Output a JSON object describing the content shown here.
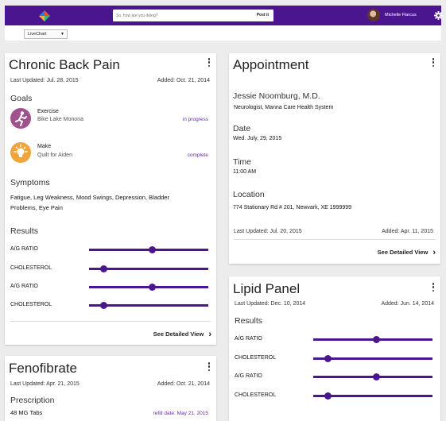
{
  "header": {
    "status_placeholder": "So, how are you doing?",
    "post_label": "Post it",
    "user_name": "Michelle Flarcus",
    "brand_color": "#4b1590"
  },
  "subbar": {
    "view_selected": "LiveChart"
  },
  "back_pain": {
    "title": "Chronic Back Pain",
    "last_updated": "Last Updated: Jul. 28, 2015",
    "added": "Added: Oct. 21, 2014",
    "goals_heading": "Goals",
    "goals": [
      {
        "title": "Exercise",
        "subtitle": "Bike Lake Monona",
        "status": "in progress",
        "icon": "running-icon"
      },
      {
        "title": "Make",
        "subtitle": "Quilt for Aiden",
        "status": "complete",
        "icon": "lightbulb-icon"
      }
    ],
    "symptoms_heading": "Symptoms",
    "symptoms_line1": "Fatigue, Leg Weakness, Mood Swings, Depression, Bladder",
    "symptoms_line2": "Problems, Eye Pain",
    "results_heading": "Results",
    "results": [
      {
        "label": "A/G RATIO",
        "level": 0.53
      },
      {
        "label": "CHOLESTEROL",
        "level": 0.12
      },
      {
        "label": "A/G RATIO",
        "level": 0.53
      },
      {
        "label": "CHOLESTEROL",
        "level": 0.12
      }
    ],
    "detail_label": "See Detailed View"
  },
  "fenofibrate": {
    "title": "Fenofibrate",
    "last_updated": "Last Updated: Apr. 21, 2015",
    "added": "Added: Oct. 21, 2014",
    "prescription_heading": "Prescription",
    "dosage": "48 MG Tabs",
    "refill": "refill date: May 21, 2015"
  },
  "appointment": {
    "title": "Appointment",
    "doctor": "Jessie Noomburg, M.D.",
    "specialty": "Neurologist, Manna Care Health System",
    "date_heading": "Date",
    "date": "Wed. July, 29, 2015",
    "time_heading": "Time",
    "time": "11:00 AM",
    "location_heading": "Location",
    "location": "774 Stationary Rd # 201, Newvark, XE 1999999",
    "last_updated": "Last Updated: Jul. 20, 2015",
    "added": "Added: Apr. 11, 2015",
    "detail_label": "See Detailed View"
  },
  "lipid": {
    "title": "Lipid Panel",
    "last_updated": "Last Updated: Dec. 10, 2014",
    "added": "Added: Jun. 14, 2014",
    "results_heading": "Results",
    "results": [
      {
        "label": "A/G RATIO",
        "level": 0.53
      },
      {
        "label": "CHOLESTEROL",
        "level": 0.12
      },
      {
        "label": "A/G RATIO",
        "level": 0.53
      },
      {
        "label": "CHOLESTEROL",
        "level": 0.12
      }
    ]
  }
}
